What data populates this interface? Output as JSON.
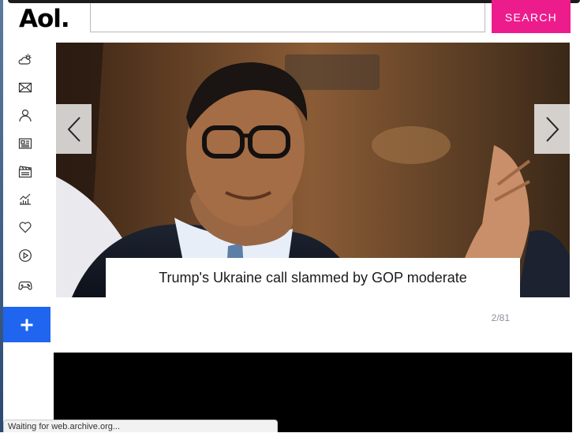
{
  "logo": {
    "text": "Aol."
  },
  "search": {
    "value": "",
    "placeholder": "",
    "button_label": "SEARCH"
  },
  "brand_colors": {
    "accent": "#ec1c8c",
    "add_button": "#1f65f0"
  },
  "sidebar": {
    "items": [
      {
        "icon": "weather-icon"
      },
      {
        "icon": "mail-icon"
      },
      {
        "icon": "user-icon"
      },
      {
        "icon": "news-icon"
      },
      {
        "icon": "entertainment-icon"
      },
      {
        "icon": "finance-icon"
      },
      {
        "icon": "lifestyle-heart-icon"
      },
      {
        "icon": "video-play-icon"
      },
      {
        "icon": "games-icon"
      }
    ],
    "add_icon": "plus-icon"
  },
  "slideshow": {
    "caption": "Trump's Ukraine call slammed by GOP moderate",
    "counter": "2/81",
    "prev_icon": "chevron-left-icon",
    "next_icon": "chevron-right-icon"
  },
  "status_bar": {
    "text": "Waiting for web.archive.org..."
  }
}
